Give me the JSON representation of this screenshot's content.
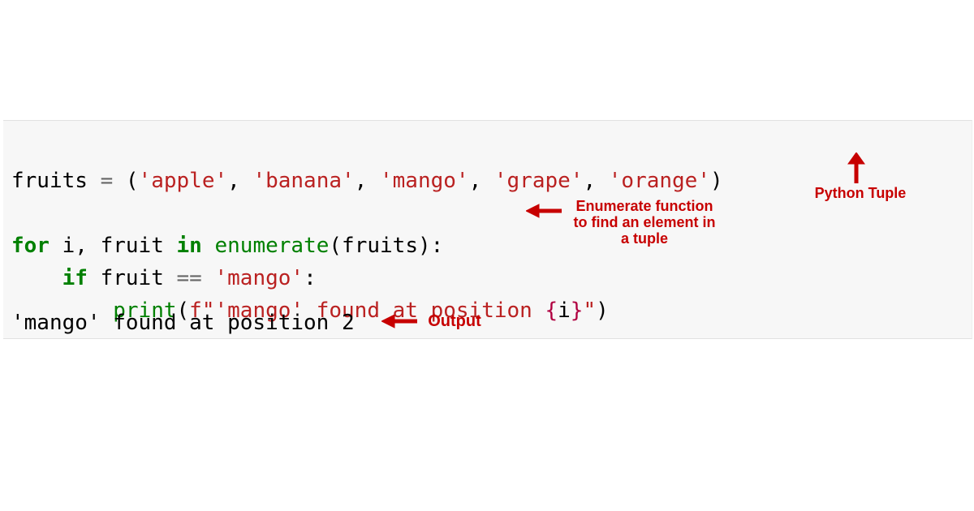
{
  "code": {
    "line1": {
      "var": "fruits",
      "eq": " = ",
      "open": "(",
      "s1": "'apple'",
      "c1": ", ",
      "s2": "'banana'",
      "c2": ", ",
      "s3": "'mango'",
      "c3": ", ",
      "s4": "'grape'",
      "c4": ", ",
      "s5": "'orange'",
      "close": ")"
    },
    "line3": {
      "kw_for": "for",
      "sp1": " ",
      "i": "i",
      "c1": ", ",
      "fruit": "fruit",
      "sp2": " ",
      "kw_in": "in",
      "sp3": " ",
      "fn": "enumerate",
      "open": "(",
      "arg": "fruits",
      "close": "):"
    },
    "line4": {
      "indent": "    ",
      "kw_if": "if",
      "sp1": " ",
      "fruit": "fruit",
      "sp2": " ",
      "eq": "==",
      "sp3": " ",
      "str": "'mango'",
      "colon": ":"
    },
    "line5": {
      "indent": "        ",
      "fn": "print",
      "open": "(",
      "fpre": "f\"'mango' found at position ",
      "iopen": "{",
      "ivar": "i",
      "iclose": "}",
      "fend": "\"",
      "close": ")"
    }
  },
  "output": {
    "text": "'mango' found at position 2"
  },
  "annotations": {
    "tuple": "Python Tuple",
    "enumerate": "Enumerate function\nto find an element in\na tuple",
    "output": "Output"
  }
}
